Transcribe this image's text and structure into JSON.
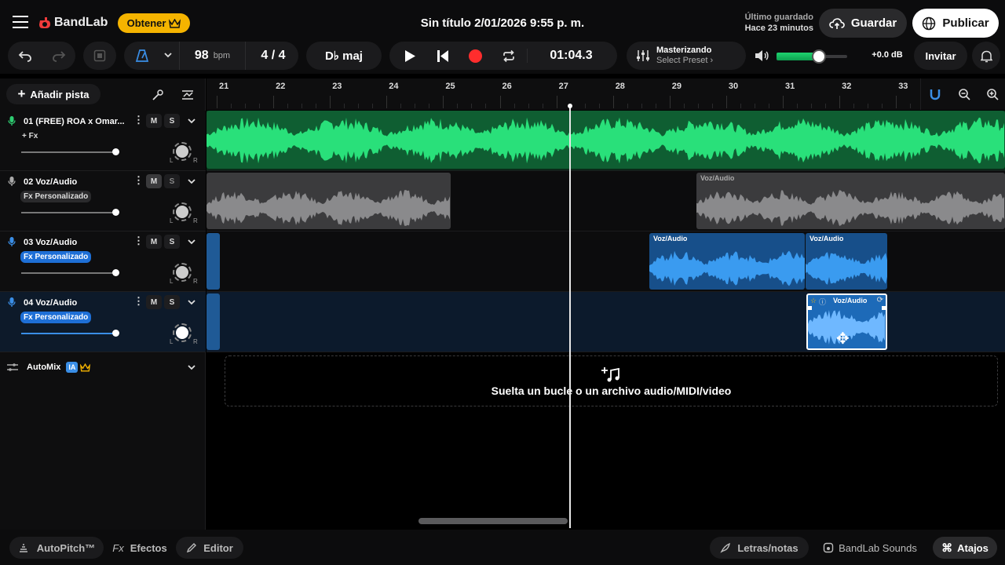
{
  "header": {
    "brand": "BandLab",
    "get_label": "Obtener",
    "project_title": "Sin título 2/01/2026 9:55 p. m.",
    "last_saved_label": "Último guardado",
    "last_saved_time": "Hace 23 minutos",
    "save_label": "Guardar",
    "publish_label": "Publicar"
  },
  "toolbar": {
    "tempo": "98",
    "tempo_unit": "bpm",
    "time_signature": "4 / 4",
    "key": "D♭ maj",
    "time": "01:04.3",
    "mastering_title": "Masterizando",
    "mastering_preset": "Select Preset ›",
    "gain": "+0.0 dB",
    "volume_level": 0.6,
    "invite_label": "Invitar"
  },
  "left": {
    "add_track_label": "Añadir pista",
    "automix_label": "AutoMix",
    "ai_badge": "IA"
  },
  "tracks": [
    {
      "name": "01  (FREE) ROA x Omar...",
      "fx": "+ Fx",
      "mute": "M",
      "solo": "S",
      "mic_color": "#2ecc71",
      "volume": 1.0
    },
    {
      "name": "02  Voz/Audio",
      "fx": "Fx Personalizado",
      "mute": "M",
      "solo": "S",
      "mic_color": "#aaaaaa",
      "volume": 1.0
    },
    {
      "name": "03  Voz/Audio",
      "fx": "Fx Personalizado",
      "mute": "M",
      "solo": "S",
      "mic_color": "#3a8ee6",
      "volume": 1.0
    },
    {
      "name": "04  Voz/Audio",
      "fx": "Fx Personalizado",
      "mute": "M",
      "solo": "S",
      "mic_color": "#3a8ee6",
      "volume": 1.0
    }
  ],
  "ruler": {
    "bars": [
      "21",
      "22",
      "23",
      "24",
      "25",
      "26",
      "27",
      "28",
      "29",
      "30",
      "31",
      "32",
      "33"
    ]
  },
  "clips": {
    "clip_2b": "Voz/Audio",
    "clip_3a": "Voz/Audio",
    "clip_3b": "Voz/Audio",
    "clip_4a": "Voz/Audio"
  },
  "drop_zone": {
    "text": "Suelta un bucle o un archivo audio/MIDI/video"
  },
  "bottom": {
    "autopitch": "AutoPitch™",
    "effects_prefix": "Fx",
    "effects": "Efectos",
    "editor": "Editor",
    "lyrics": "Letras/notas",
    "sounds": "BandLab Sounds",
    "shortcuts": "Atajos"
  },
  "colors": {
    "accent_green": "#1ed46f",
    "accent_blue": "#3a8ee6",
    "record_red": "#ff2d2d",
    "gold": "#f5b400"
  }
}
